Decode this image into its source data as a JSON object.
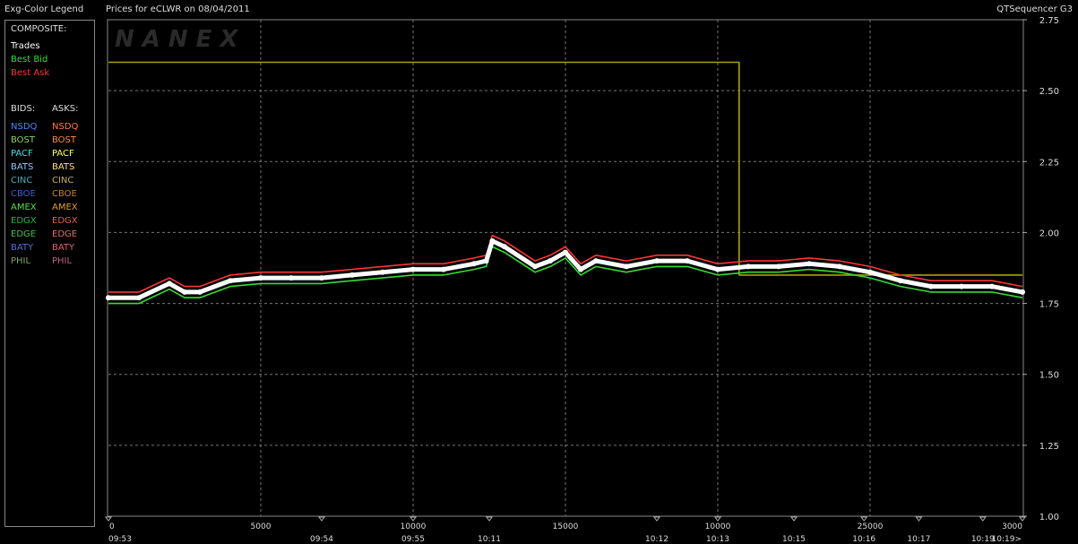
{
  "header": {
    "legend_title": "Exg-Color Legend",
    "prices_for": "Prices for  eCLWR  on  08/04/2011",
    "app_name": "QTSequencer G3"
  },
  "legend": {
    "composite_title": "COMPOSITE:",
    "composite": [
      {
        "label": "Trades",
        "color": "#ffffff"
      },
      {
        "label": "Best Bid",
        "color": "#33dd33"
      },
      {
        "label": "Best Ask",
        "color": "#ff3333"
      }
    ],
    "bids_title": "BIDS:",
    "asks_title": "ASKS:",
    "rows": [
      {
        "bid": "NSDQ",
        "bid_color": "#4a86ff",
        "ask": "NSDQ",
        "ask_color": "#ff7a3d"
      },
      {
        "bid": "BOST",
        "bid_color": "#8fd45a",
        "ask": "BOST",
        "ask_color": "#ff8c4a"
      },
      {
        "bid": "PACF",
        "bid_color": "#44e0e0",
        "ask": "PACF",
        "ask_color": "#ffff55"
      },
      {
        "bid": "BATS",
        "bid_color": "#8cc8ff",
        "ask": "BATS",
        "ask_color": "#ffe080"
      },
      {
        "bid": "CINC",
        "bid_color": "#4fa8b8",
        "ask": "CINC",
        "ask_color": "#c8b050"
      },
      {
        "bid": "CBOE",
        "bid_color": "#3060c8",
        "ask": "CBOE",
        "ask_color": "#c88030"
      },
      {
        "bid": "AMEX",
        "bid_color": "#50e050",
        "ask": "AMEX",
        "ask_color": "#e0a020"
      },
      {
        "bid": "EDGX",
        "bid_color": "#30b050",
        "ask": "EDGX",
        "ask_color": "#e06050"
      },
      {
        "bid": "EDGE",
        "bid_color": "#40c040",
        "ask": "EDGE",
        "ask_color": "#e07060"
      },
      {
        "bid": "BATY",
        "bid_color": "#5070e0",
        "ask": "BATY",
        "ask_color": "#e06070"
      },
      {
        "bid": "PHIL",
        "bid_color": "#80a060",
        "ask": "PHIL",
        "ask_color": "#c06080"
      }
    ]
  },
  "watermark": "NANEX",
  "chart_data": {
    "type": "line",
    "title": "Prices for  eCLWR  on  08/04/2011",
    "ylim": [
      1.0,
      2.75
    ],
    "y_ticks": [
      "1.00",
      "1.25",
      "1.50",
      "1.75",
      "2.00",
      "2.25",
      "2.50",
      "2.75"
    ],
    "x_range": [
      0,
      30000
    ],
    "x_seq_ticks": [
      {
        "x": 0,
        "label": "0"
      },
      {
        "x": 5000,
        "label": "5000"
      },
      {
        "x": 10000,
        "label": "10000"
      },
      {
        "x": 15000,
        "label": "15000"
      },
      {
        "x": 20000,
        "label": "10000"
      },
      {
        "x": 25000,
        "label": "25000"
      },
      {
        "x": 30000,
        "label": "3000"
      }
    ],
    "x_time_ticks": [
      {
        "x": 0,
        "label": "09:53"
      },
      {
        "x": 7000,
        "label": "09:54"
      },
      {
        "x": 10000,
        "label": "09:55"
      },
      {
        "x": 12500,
        "label": "10:11"
      },
      {
        "x": 18000,
        "label": "10:12"
      },
      {
        "x": 20000,
        "label": "10:13"
      },
      {
        "x": 22500,
        "label": "10:15"
      },
      {
        "x": 24800,
        "label": "10:16"
      },
      {
        "x": 26600,
        "label": "10:17"
      },
      {
        "x": 28700,
        "label": "10:19"
      },
      {
        "x": 30000,
        "label": "10:19>"
      }
    ],
    "grid": true,
    "series": [
      {
        "color": "#ffffff",
        "x": [
          0,
          1000,
          2000,
          2500,
          3000,
          4000,
          5000,
          6000,
          7000,
          8000,
          9000,
          10000,
          11000,
          12000,
          12400,
          12600,
          13000,
          14000,
          14500,
          15000,
          15500,
          16000,
          17000,
          18000,
          19000,
          20000,
          21000,
          22000,
          23000,
          24000,
          25000,
          26000,
          27000,
          28000,
          29000,
          30000
        ],
        "y": [
          1.77,
          1.77,
          1.82,
          1.79,
          1.79,
          1.83,
          1.84,
          1.84,
          1.84,
          1.85,
          1.86,
          1.87,
          1.87,
          1.89,
          1.9,
          1.97,
          1.95,
          1.88,
          1.9,
          1.93,
          1.87,
          1.9,
          1.88,
          1.9,
          1.9,
          1.87,
          1.88,
          1.88,
          1.89,
          1.88,
          1.86,
          1.83,
          1.81,
          1.81,
          1.81,
          1.79
        ]
      },
      {
        "color": "#ff3333",
        "x": [
          0,
          1000,
          2000,
          2500,
          3000,
          4000,
          5000,
          6000,
          7000,
          8000,
          9000,
          10000,
          11000,
          12000,
          12400,
          12600,
          13000,
          14000,
          14500,
          15000,
          15500,
          16000,
          17000,
          18000,
          19000,
          20000,
          21000,
          22000,
          23000,
          24000,
          25000,
          26000,
          27000,
          28000,
          29000,
          30000
        ],
        "y": [
          1.79,
          1.79,
          1.84,
          1.81,
          1.81,
          1.85,
          1.86,
          1.86,
          1.86,
          1.87,
          1.88,
          1.89,
          1.89,
          1.91,
          1.92,
          1.99,
          1.97,
          1.9,
          1.92,
          1.95,
          1.89,
          1.92,
          1.9,
          1.92,
          1.92,
          1.89,
          1.9,
          1.9,
          1.91,
          1.9,
          1.88,
          1.85,
          1.83,
          1.83,
          1.83,
          1.81
        ]
      },
      {
        "color": "#33dd33",
        "x": [
          0,
          1000,
          2000,
          2500,
          3000,
          4000,
          5000,
          6000,
          7000,
          8000,
          9000,
          10000,
          11000,
          12000,
          12400,
          12600,
          13000,
          14000,
          14500,
          15000,
          15500,
          16000,
          17000,
          18000,
          19000,
          20000,
          21000,
          22000,
          23000,
          24000,
          25000,
          26000,
          27000,
          28000,
          29000,
          30000
        ],
        "y": [
          1.75,
          1.75,
          1.8,
          1.77,
          1.77,
          1.81,
          1.82,
          1.82,
          1.82,
          1.83,
          1.84,
          1.85,
          1.85,
          1.87,
          1.88,
          1.95,
          1.93,
          1.86,
          1.88,
          1.91,
          1.85,
          1.88,
          1.86,
          1.88,
          1.88,
          1.85,
          1.86,
          1.86,
          1.87,
          1.86,
          1.84,
          1.81,
          1.79,
          1.79,
          1.79,
          1.77
        ]
      },
      {
        "color": "#a8a010",
        "x": [
          0,
          8000,
          8000,
          12500,
          12500,
          20700,
          20700,
          30000
        ],
        "y": [
          2.6,
          2.6,
          2.6,
          2.6,
          2.6,
          2.6,
          1.85,
          1.85
        ]
      }
    ]
  }
}
